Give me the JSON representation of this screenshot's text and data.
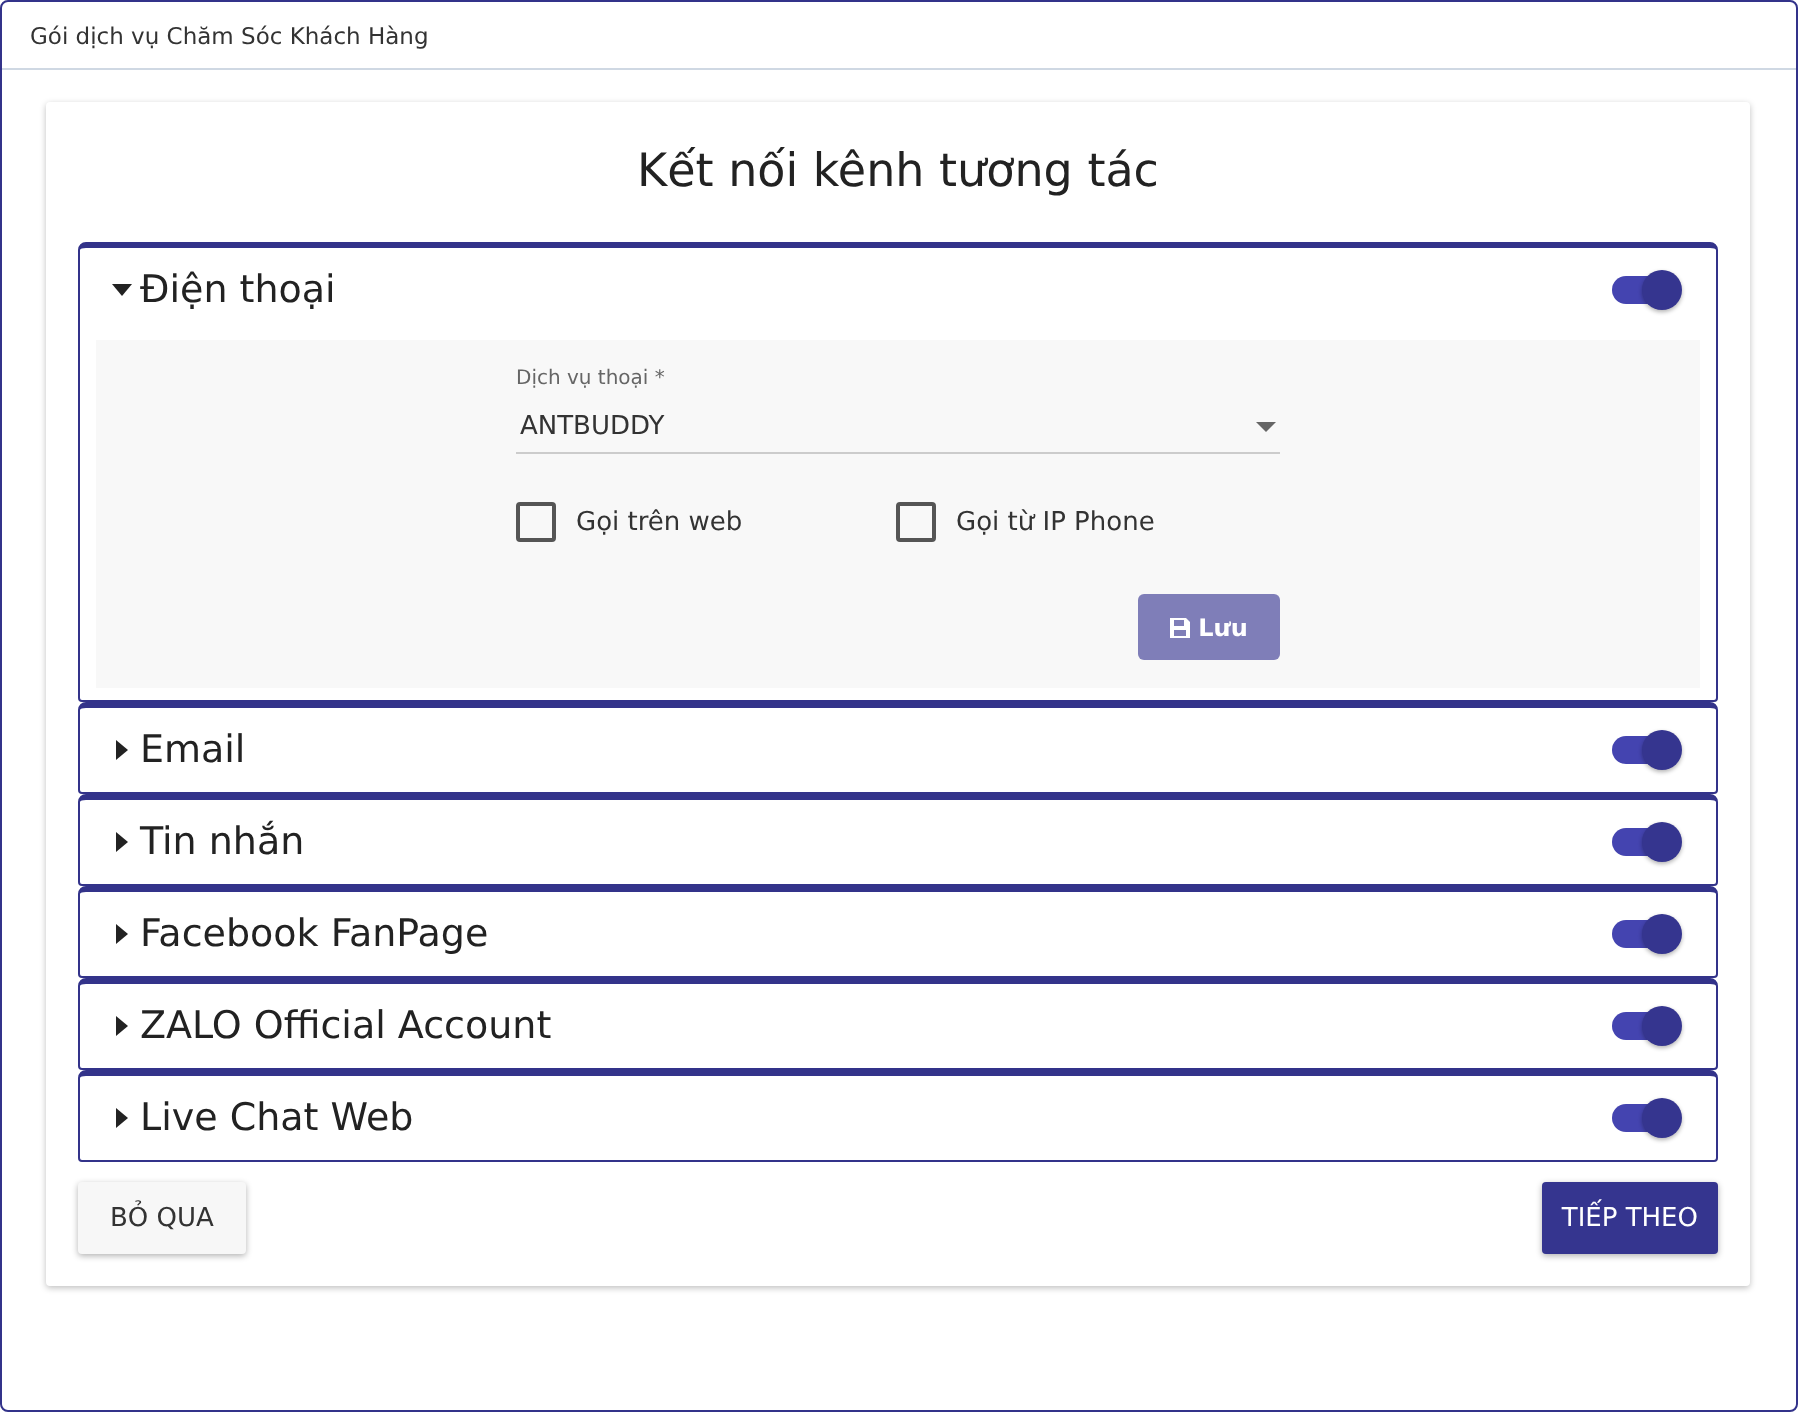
{
  "window": {
    "title": "Gói dịch vụ Chăm Sóc Khách Hàng"
  },
  "heading": "Kết nối kênh tương tác",
  "channels": [
    {
      "label": "Điện thoại",
      "expanded": true,
      "on": true
    },
    {
      "label": "Email",
      "expanded": false,
      "on": true
    },
    {
      "label": "Tin nhắn",
      "expanded": false,
      "on": true
    },
    {
      "label": "Facebook FanPage",
      "expanded": false,
      "on": true
    },
    {
      "label": "ZALO Official Account",
      "expanded": false,
      "on": true
    },
    {
      "label": "Live Chat Web",
      "expanded": false,
      "on": true
    }
  ],
  "phone_form": {
    "service": {
      "label": "Dịch vụ thoại *",
      "value": "ANTBUDDY"
    },
    "options": [
      {
        "label": "Gọi trên web",
        "checked": false
      },
      {
        "label": "Gọi từ IP Phone",
        "checked": false
      }
    ],
    "save_button": "Lưu"
  },
  "buttons": {
    "skip": "BỎ QUA",
    "next": "TIẾP THEO"
  }
}
